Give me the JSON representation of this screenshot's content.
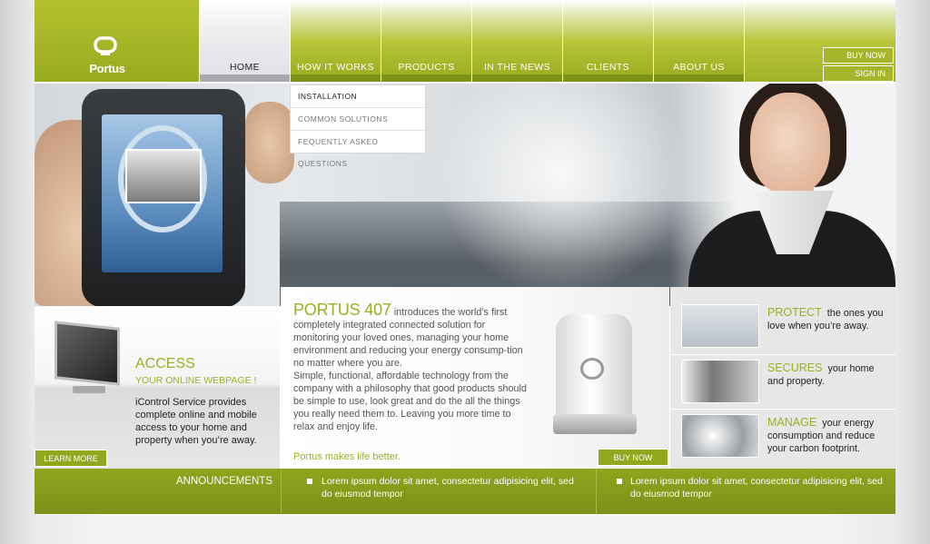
{
  "brand": {
    "name": "Portus"
  },
  "nav": {
    "items": [
      {
        "label": "HOME",
        "active": true
      },
      {
        "label": "HOW IT WORKS",
        "active": false
      },
      {
        "label": "PRODUCTS",
        "active": false
      },
      {
        "label": "IN THE NEWS",
        "active": false
      },
      {
        "label": "CLIENTS",
        "active": false
      },
      {
        "label": "ABOUT US",
        "active": false
      }
    ],
    "dropdown": [
      "INSTALLATION",
      "COMMON SOLUTIONS",
      "FEQUENTLY ASKED QUESTIONS"
    ]
  },
  "header_buttons": {
    "buy_now": "BUY NOW",
    "sign_in": "SIGN IN"
  },
  "access": {
    "title": "ACCESS",
    "subtitle": "YOUR ONLINE WEBPAGE !",
    "text": "iControl Service provides complete online and mobile access to your home and property when you’re away.",
    "button": "LEARN  MORE"
  },
  "product": {
    "title": "PORTUS 407",
    "intro": "introduces the world’s first completely integrated connected solution for monitoring your loved ones, managing your home environment and reducing your energy consump-tion no matter where you are.",
    "body": "Simple, functional, affordable technology from the company with a philosophy that good products should be simple to use, look great and do the all the things you really need them to. Leaving you more time to relax and enjoy life.",
    "tagline": "Portus makes life better.",
    "button": "BUY NOW"
  },
  "features": [
    {
      "keyword": "PROTECT",
      "text": "the ones you love when you’re away."
    },
    {
      "keyword": "SECURES",
      "text": "your home and property."
    },
    {
      "keyword": "MANAGE",
      "text": "your energy consumption and reduce your carbon footprint."
    }
  ],
  "announcements": {
    "label": "ANNOUNCEMENTS",
    "items": [
      "Lorem ipsum dolor sit amet, consectetur adipisicing elit, sed do eiusmod tempor",
      "Lorem ipsum dolor sit amet, consectetur adipisicing elit, sed do eiusmod tempor"
    ]
  },
  "colors": {
    "brand_green": "#9ab022",
    "dark_green": "#7d9018"
  }
}
